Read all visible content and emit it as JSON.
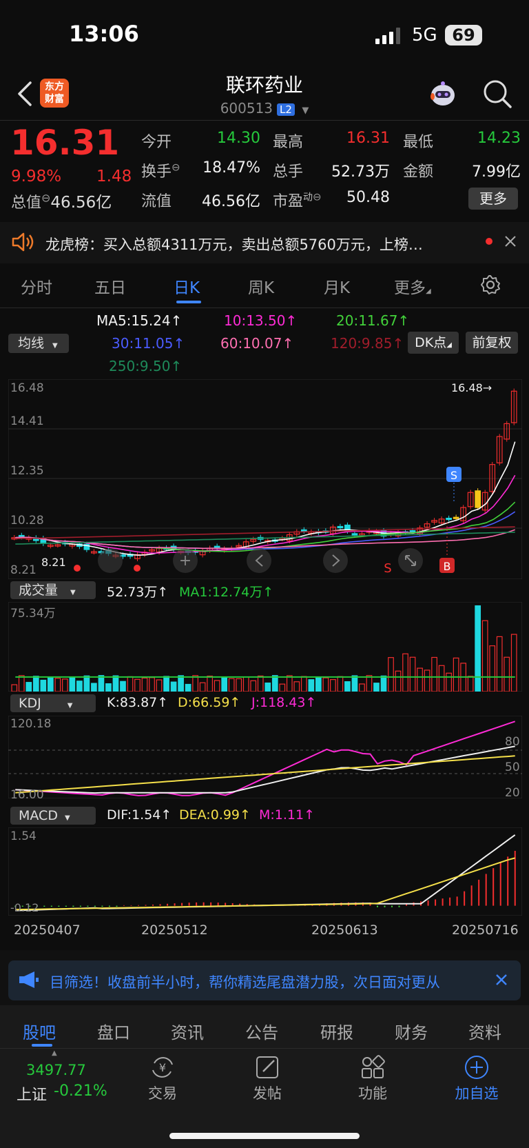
{
  "status_bar": {
    "time": "13:06",
    "network": "5G",
    "battery": "69"
  },
  "header": {
    "title": "联环药业",
    "code": "600513",
    "level_badge": "L2",
    "logo_line1": "东方",
    "logo_line2": "财富"
  },
  "quote": {
    "price": "16.31",
    "change_pct": "9.98%",
    "change": "1.48",
    "open_label": "今开",
    "open": "14.30",
    "high_label": "最高",
    "high": "16.31",
    "low_label": "最低",
    "low": "14.23",
    "turnover_label": "换手",
    "turnover": "18.47%",
    "volume_label": "总手",
    "volume": "52.73万",
    "amount_label": "金额",
    "amount": "7.99亿",
    "total_mv_label": "总值",
    "total_mv": "46.56亿",
    "float_mv_label": "流值",
    "float_mv": "46.56亿",
    "pe_label": "市盈",
    "pe_sup": "动",
    "pe": "50.48",
    "more_button": "更多"
  },
  "notice": {
    "text": "龙虎榜：买入总额4311万元，卖出总额5760万元，上榜…"
  },
  "period_tabs": [
    "分时",
    "五日",
    "日K",
    "周K",
    "月K",
    "更多"
  ],
  "active_period": "日K",
  "ma_legend": {
    "selector": "均线",
    "ma5": "MA5:15.24↑",
    "ma10": "10:13.50↑",
    "ma20": "20:11.67↑",
    "ma30": "30:11.05↑",
    "ma60": "60:10.07↑",
    "ma120": "120:9.85↑",
    "ma250": "250:9.50↑",
    "dk_button": "DK点",
    "adjust_button": "前复权"
  },
  "colors": {
    "up": "#f42e2e",
    "down": "#1fd8e0",
    "ma5": "#ffffff",
    "ma10": "#ff2bd6",
    "ma20": "#42d13a",
    "ma30": "#4b5cff",
    "ma60": "#ff6fb1",
    "ma120": "#a01d2b",
    "ma250": "#1e8a5a",
    "accent": "#3f86ff"
  },
  "price_chart": {
    "y_labels": [
      "16.48",
      "14.41",
      "12.35",
      "10.28",
      "8.21"
    ],
    "max_marker": "16.48→",
    "min_marker": "8.21",
    "sell_marker": "S",
    "buy_marker": "B"
  },
  "volume_panel": {
    "selector": "成交量",
    "value": "52.73万↑",
    "ma1": "MA1:12.74万↑",
    "top_label": "75.34万"
  },
  "kdj_panel": {
    "selector": "KDJ",
    "k": "K:83.87↑",
    "d": "D:66.59↑",
    "j": "J:118.43↑",
    "top_label": "120.18",
    "bottom_label": "16.00",
    "levels": [
      "80",
      "50",
      "20"
    ]
  },
  "macd_panel": {
    "selector": "MACD",
    "dif": "DIF:1.54↑",
    "dea": "DEA:0.99↑",
    "m": "M:1.11↑",
    "top_label": "1.54",
    "bottom_label": "-0.12"
  },
  "x_axis": [
    "20250407",
    "20250512",
    "20250613",
    "20250716"
  ],
  "chart_data": {
    "type": "candlestick",
    "title": "",
    "ylim": [
      8.21,
      16.48
    ],
    "recent_closes": [
      10.9,
      11.6,
      12.9,
      14.2,
      14.8,
      16.31
    ],
    "ma_values": {
      "MA5": 15.24,
      "MA10": 13.5,
      "MA20": 11.67,
      "MA30": 11.05,
      "MA60": 10.07,
      "MA120": 9.85,
      "MA250": 9.5
    },
    "volume_max": 75.34,
    "kdj_range": [
      16.0,
      120.18
    ],
    "macd_range": [
      -0.12,
      1.54
    ]
  },
  "banner": {
    "text": "目筛选！收盘前半小时，帮你精选尾盘潜力股，次日面对更从"
  },
  "bottom_tabs": [
    "股吧",
    "盘口",
    "资讯",
    "公告",
    "研报",
    "财务",
    "资料"
  ],
  "active_bottom_tab": "股吧",
  "index_ticker": {
    "value": "3497.77",
    "name": "上证",
    "change": "-0.21%"
  },
  "actions": [
    "交易",
    "发帖",
    "功能",
    "加自选"
  ]
}
